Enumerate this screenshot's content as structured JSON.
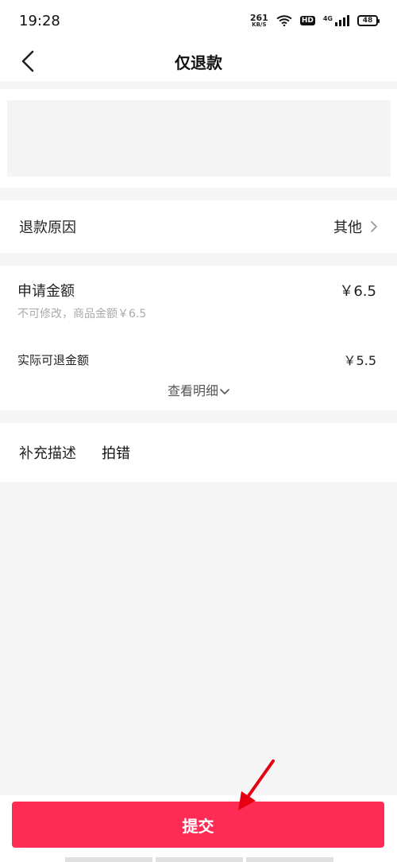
{
  "status": {
    "time": "19:28",
    "netspeed": "261",
    "netspeed_unit": "KB/S",
    "hd": "HD",
    "net_type": "4G",
    "battery": "48"
  },
  "nav": {
    "title": "仅退款"
  },
  "reason": {
    "label": "退款原因",
    "value": "其他"
  },
  "amount": {
    "apply_label": "申请金额",
    "apply_value": "￥6.5",
    "hint": "不可修改，商品金额￥6.5",
    "actual_label": "实际可退金额",
    "actual_value": "￥5.5",
    "detail_link": "查看明细"
  },
  "description": {
    "label": "补充描述",
    "value": "拍错"
  },
  "footer": {
    "submit_label": "提交"
  },
  "colors": {
    "accent": "#fe2c55",
    "annotation_arrow": "#e60012"
  }
}
